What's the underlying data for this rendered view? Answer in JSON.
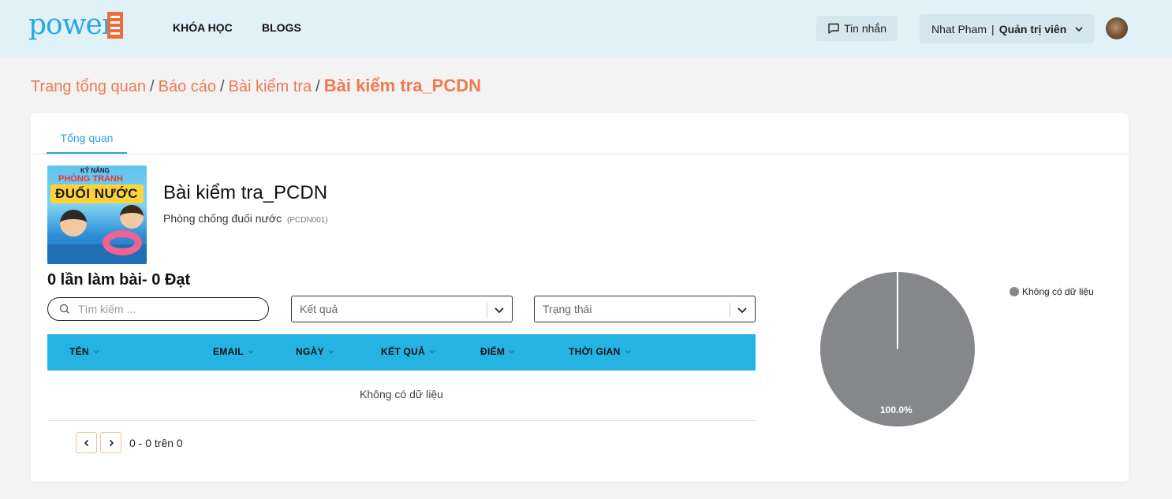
{
  "header": {
    "logo_text": "power",
    "nav": [
      "KHÓA HỌC",
      "BLOGS"
    ],
    "messages_label": "Tin nhắn",
    "user_name": "Nhat Pham",
    "user_role": "Quản trị viên"
  },
  "breadcrumb": {
    "items": [
      "Trang tổng quan",
      "Báo cáo",
      "Bài kiểm tra"
    ],
    "current": "Bài kiểm tra_PCDN"
  },
  "tabs": [
    "Tổng quan"
  ],
  "quiz": {
    "thumbnail_text": [
      "KỸ NĂNG",
      "PHÒNG TRÁNH",
      "ĐUỐI NƯỚC"
    ],
    "title": "Bài kiểm tra_PCDN",
    "course": "Phòng chống đuối nước",
    "code": "(PCDN001)",
    "attempts_summary": "0 lần làm bài- 0 Đạt"
  },
  "filters": {
    "search_placeholder": "Tìm kiếm ...",
    "result_placeholder": "Kết quả",
    "status_placeholder": "Trạng thái"
  },
  "table": {
    "columns": [
      "TÊN",
      "EMAIL",
      "NGÀY",
      "KẾT QUẢ",
      "ĐIỂM",
      "THỜI GIAN"
    ],
    "empty_text": "Không có dữ liệu"
  },
  "pagination": {
    "text": "0 - 0 trên 0"
  },
  "chart_data": {
    "type": "pie",
    "labels": [
      "Không có dữ liệu"
    ],
    "values": [
      100.0
    ],
    "data_labels": [
      "100.0%"
    ],
    "colors": [
      "#85878b"
    ],
    "legend_position": "top-right"
  },
  "colors": {
    "accent": "#25b3e4",
    "breadcrumb": "#ef7a4f",
    "header_bg": "#e1f1f8"
  }
}
